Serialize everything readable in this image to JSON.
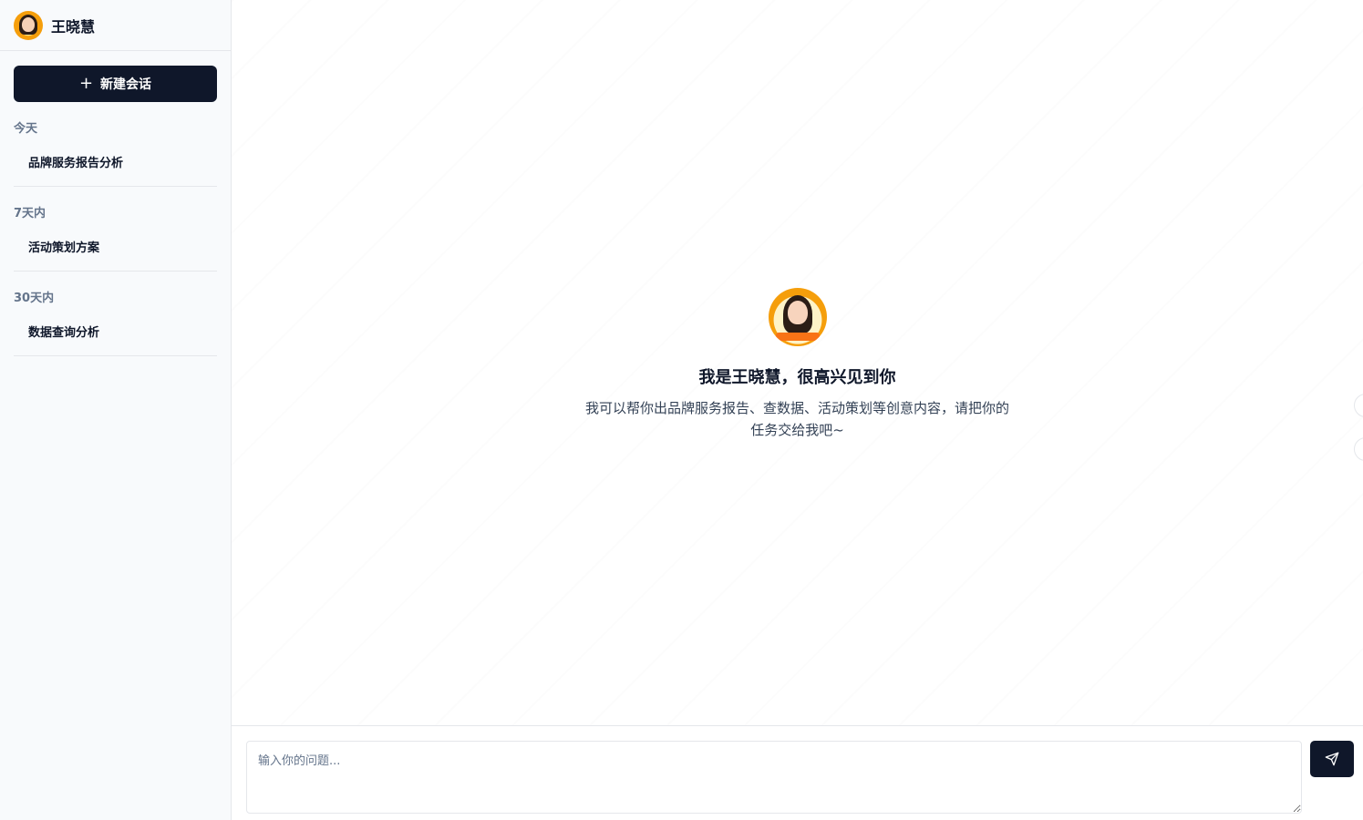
{
  "user": {
    "name": "王晓慧"
  },
  "sidebar": {
    "new_chat_label": "新建会话",
    "groups": [
      {
        "title": "今天",
        "items": [
          "品牌服务报告分析"
        ]
      },
      {
        "title": "7天内",
        "items": [
          "活动策划方案"
        ]
      },
      {
        "title": "30天内",
        "items": [
          "数据查询分析"
        ]
      }
    ]
  },
  "welcome": {
    "title": "我是王晓慧，很高兴见到你",
    "description": "我可以帮你出品牌服务报告、查数据、活动策划等创意内容，请把你的任务交给我吧~"
  },
  "input": {
    "placeholder": "输入你的问题..."
  },
  "icons": {
    "new_chat": "plus-icon",
    "send": "send-icon"
  },
  "colors": {
    "primary": "#0f172a",
    "sidebar_bg": "#f8fafc",
    "muted": "#64748b"
  }
}
